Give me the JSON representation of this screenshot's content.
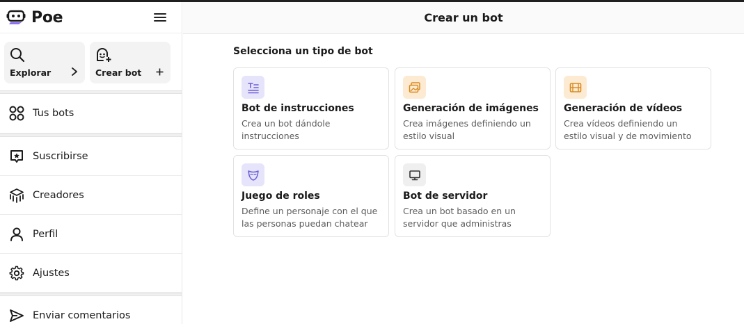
{
  "app": {
    "name": "Poe"
  },
  "sidebar": {
    "quick_actions": [
      {
        "label": "Explorar",
        "icon": "search-icon",
        "action_icon": "chevron-right-icon"
      },
      {
        "label": "Crear bot",
        "icon": "bot-plus-icon",
        "action_icon": "plus-icon"
      }
    ],
    "items": [
      {
        "label": "Tus bots",
        "icon": "bots-grid-icon"
      },
      {
        "label": "Suscribirse",
        "icon": "star-badge-icon"
      },
      {
        "label": "Creadores",
        "icon": "creators-icon"
      },
      {
        "label": "Perfil",
        "icon": "user-icon"
      },
      {
        "label": "Ajustes",
        "icon": "gear-icon"
      },
      {
        "label": "Enviar comentarios",
        "icon": "send-icon"
      }
    ]
  },
  "main": {
    "title": "Crear un bot",
    "section_title": "Selecciona un tipo de bot",
    "cards": [
      {
        "title": "Bot de instrucciones",
        "description": "Crea un bot dándole instrucciones",
        "icon": "text-lines-icon",
        "icon_bg": "#e6e4fb",
        "icon_color": "#6b5fd6"
      },
      {
        "title": "Generación de imágenes",
        "description": "Crea imágenes definiendo un estilo visual",
        "icon": "images-icon",
        "icon_bg": "#fcebd2",
        "icon_color": "#d9891f"
      },
      {
        "title": "Generación de vídeos",
        "description": "Crea vídeos definiendo un estilo visual y de movimiento",
        "icon": "film-icon",
        "icon_bg": "#fcebd2",
        "icon_color": "#d9891f"
      },
      {
        "title": "Juego de roles",
        "description": "Define un personaje con el que las personas puedan chatear",
        "icon": "mask-icon",
        "icon_bg": "#e6e4fb",
        "icon_color": "#6b5fd6"
      },
      {
        "title": "Bot de servidor",
        "description": "Crea un bot basado en un servidor que administras",
        "icon": "monitor-icon",
        "icon_bg": "#efefef",
        "icon_color": "#333333"
      }
    ]
  }
}
